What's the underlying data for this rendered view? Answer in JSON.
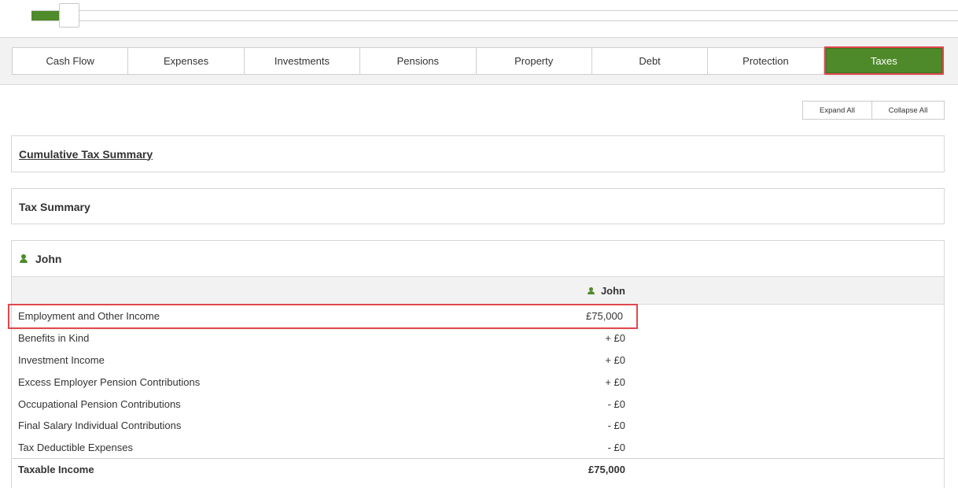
{
  "slider": {
    "fill_fraction": 0.03
  },
  "tabs": [
    {
      "label": "Cash Flow"
    },
    {
      "label": "Expenses"
    },
    {
      "label": "Investments"
    },
    {
      "label": "Pensions"
    },
    {
      "label": "Property"
    },
    {
      "label": "Debt"
    },
    {
      "label": "Protection"
    },
    {
      "label": "Taxes",
      "active": true
    }
  ],
  "toolbar": {
    "expand_label": "Expand All",
    "collapse_label": "Collapse All"
  },
  "panels": {
    "cumulative": {
      "title": "Cumulative Tax Summary"
    },
    "summary": {
      "title": "Tax Summary"
    },
    "person": {
      "title": "John",
      "column_header": "John",
      "rows": [
        {
          "label": "Employment and Other Income",
          "value": "£75,000"
        },
        {
          "label": "Benefits in Kind",
          "value": "+ £0"
        },
        {
          "label": "Investment Income",
          "value": "+ £0"
        },
        {
          "label": "Excess Employer Pension Contributions",
          "value": "+ £0"
        },
        {
          "label": "Occupational Pension Contributions",
          "value": "- £0"
        },
        {
          "label": "Final Salary Individual Contributions",
          "value": "- £0"
        },
        {
          "label": "Tax Deductible Expenses",
          "value": "- £0"
        }
      ],
      "total": {
        "label": "Taxable Income",
        "value": "£75,000"
      }
    }
  },
  "colors": {
    "accent": "#4e8a2a",
    "highlight": "#e0484c"
  },
  "icons": {
    "person": "person-icon"
  }
}
